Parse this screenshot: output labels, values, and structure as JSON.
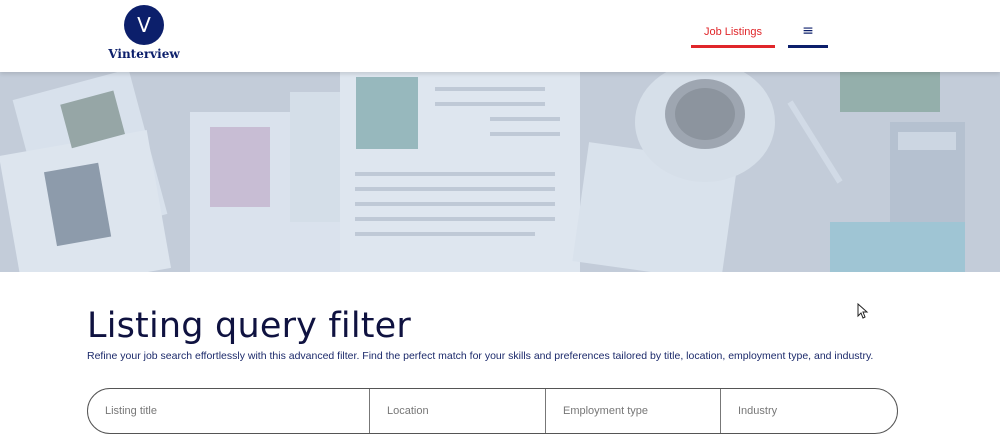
{
  "brand": {
    "logo_letter": "V",
    "name": "Vinterview",
    "primary_color": "#0c1f6b"
  },
  "nav": {
    "job_listings_label": "Job Listings",
    "job_listings_color": "#e0262a",
    "menu_icon": "hamburger-menu-icon",
    "menu_glyph": "≡"
  },
  "main": {
    "title": "Listing query filter",
    "description": "Refine your job search effortlessly with this advanced filter. Find the perfect match for your skills and preferences tailored by title, location, employment type, and industry."
  },
  "filter": {
    "listing_title_placeholder": "Listing title",
    "location_placeholder": "Location",
    "employment_type_placeholder": "Employment type",
    "industry_placeholder": "Industry"
  }
}
